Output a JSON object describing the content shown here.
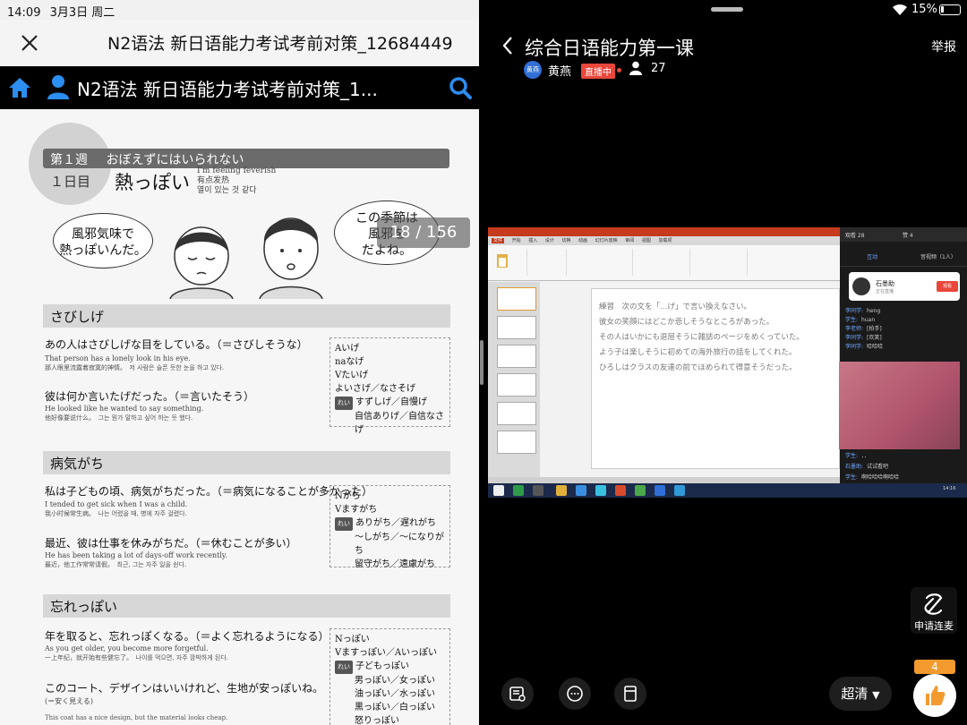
{
  "status_left": {
    "time": "14:09",
    "date": "3月3日 周二"
  },
  "doc_titlebar": {
    "title": "N2语法 新日语能力考试考前对策_12684449"
  },
  "doc_navbar": {
    "title": "N2语法 新日语能力考试考前对策_1..."
  },
  "page": {
    "week_label": "第１週",
    "week_title": "おぼえずにはいられない",
    "day_label": "１日目",
    "main_word": "熱っぽい",
    "main_word_en": [
      "I'm feeling feverish",
      "有点发热",
      "열이 있는 것 같다"
    ],
    "bubble_left": [
      "風邪気味で",
      "熱っぽいんだ。"
    ],
    "bubble_right": [
      "この季節は",
      "風邪を",
      "だよね。"
    ],
    "page_indicator": "18 / 156",
    "sections": [
      {
        "title": "さびしげ",
        "examples": [
          {
            "jp": "あの人はさびしげな目をしている。（＝さびしそうな）",
            "en": "That person has a lonely look in his eye.",
            "tr": "那人眼里流露着寂寞的神情。　저 사람은 슬픈 듯한 눈을 하고 있다."
          },
          {
            "jp": "彼は何か言いたげだった。（＝言いたそう）",
            "en": "He looked like he wanted to say something.",
            "tr": "他好像要说什么。　그는 뭔가 말하고 싶어 하는 듯 했다."
          }
        ],
        "conj": [
          "Aいげ",
          "naなげ",
          "Vたいげ",
          "よいさげ／なさそげ",
          "すずしげ／自慢げ",
          "自信ありげ／自信なさげ"
        ]
      },
      {
        "title": "病気がち",
        "examples": [
          {
            "jp": "私は子どもの頃、病気がちだった。（＝病気になることが多かった）",
            "en": "I tended to get sick when I was a child.",
            "tr": "我小时候常生病。　나는 어렸을 때, 병에 자주 걸렸다."
          },
          {
            "jp": "最近、彼は仕事を休みがちだ。（＝休むことが多い）",
            "en": "He has been taking a lot of days-off work recently.",
            "tr": "最近，他工作常常请假。　최근, 그는 자주 일을 쉰다."
          }
        ],
        "conj": [
          "Nがち",
          "Vますがち",
          "ありがち／遅れがち",
          "〜しがち／〜になりがち",
          "留守がち／遠慮がち"
        ]
      },
      {
        "title": "忘れっぽい",
        "examples": [
          {
            "jp": "年を取ると、忘れっぽくなる。（＝よく忘れるようになる）",
            "en": "As you get older, you become more forgetful.",
            "tr": "一上年纪，就开始有些健忘了。　나이를 먹으면, 자주 깜박하게 된다."
          },
          {
            "jp": "このコート、デザインはいいけれど、生地が安っぽいね。",
            "en": "(＝安く見える)",
            "tr": "This coat has a nice design, but the material looks cheap."
          }
        ],
        "conj": [
          "Nっぽい",
          "Vますっぽい／Aいっぽい",
          "子どもっぽい",
          "男っぽい／女っぽい",
          "油っぽい／水っぽい",
          "黒っぽい／白っぽい",
          "怒りっぽい"
        ]
      }
    ],
    "example_tag": "れい"
  },
  "status_right": {
    "battery": "15%"
  },
  "live": {
    "course_title": "综合日语能力第一课",
    "report": "举报",
    "teacher_avatar": "黄燕",
    "teacher_name": "黄燕",
    "live_badge": "直播中",
    "viewers": "27"
  },
  "stream": {
    "slide_lines": [
      "練習　次の文を「…げ」で言い換えなさい。",
      "彼女の笑顔にはどこか悲しそうなところがあった。",
      "その人はいかにも退屈そうに雑誌のページをめくっていた。",
      "よう子は楽しそうに初めての海外旅行の話をしてくれた。",
      "ひろしはクラスの友達の前でほめられて得意そうだった。"
    ],
    "ppt_tabs": [
      "文件",
      "开始",
      "插入",
      "设计",
      "切换",
      "动画",
      "幻灯片放映",
      "审阅",
      "视图",
      "加载项"
    ],
    "chat_top": [
      "观看 28",
      "赞 4"
    ],
    "chat_tabs": [
      "互动",
      "音视频（1人）"
    ],
    "chat_pin_name": "石墨助",
    "chat_pin_sub": "正在直播",
    "chat_pin_btn": "观看",
    "chat_lines": [
      {
        "name": "李同学:",
        "msg": "heng"
      },
      {
        "name": "学生:",
        "msg": "huan"
      },
      {
        "name": "李老师:",
        "msg": "[拍手]"
      },
      {
        "name": "李同学:",
        "msg": "[欢笑]"
      },
      {
        "name": "李同学:",
        "msg": "哈哈哈"
      },
      {
        "name": "学生:",
        "msg": "．．"
      },
      {
        "name": "石墨助:",
        "msg": "试试看吧"
      },
      {
        "name": "学生:",
        "msg": "啊哈哈哈啊哈哈"
      }
    ],
    "clock": "14:16"
  },
  "controls": {
    "apply_mic": "申请连麦",
    "quality": "超清",
    "likes": "4"
  }
}
